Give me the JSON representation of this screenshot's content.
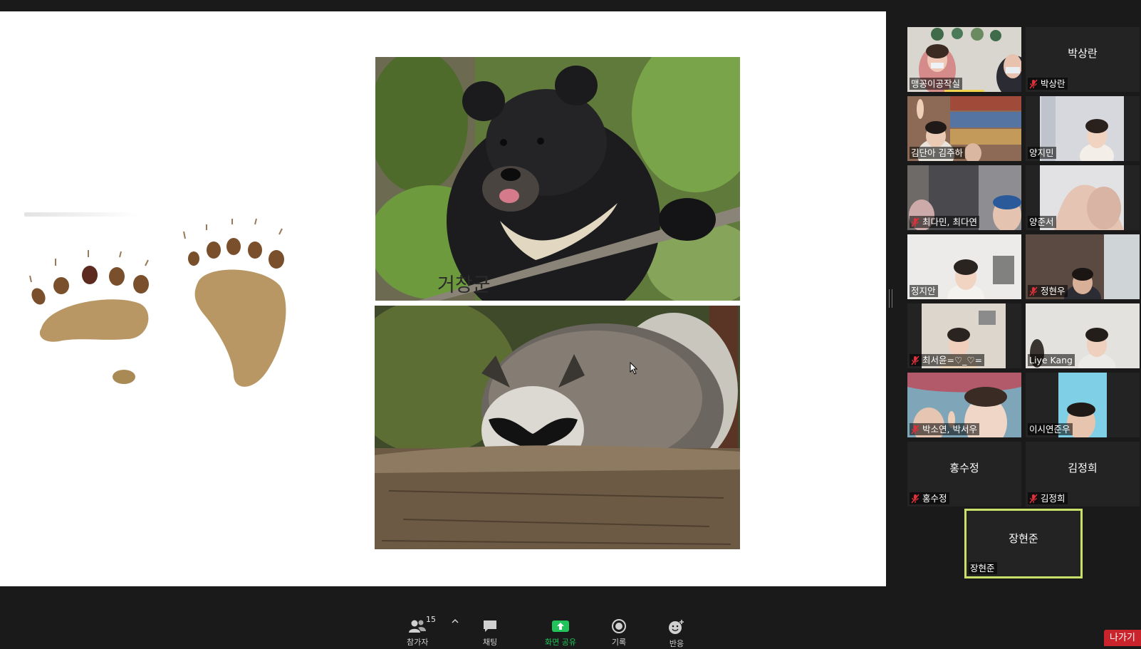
{
  "slide": {
    "annotation_text": "거창군",
    "images": {
      "top": "bear",
      "bottom": "raccoon"
    }
  },
  "gallery": {
    "tiles": [
      {
        "label": "맹꽁이공작실",
        "muted": false,
        "video": true,
        "speaking": true
      },
      {
        "label": "박상란",
        "center_name": "박상란",
        "muted": true,
        "video": false
      },
      {
        "label": "김단아 김주하",
        "muted": false,
        "video": true
      },
      {
        "label": "양지민",
        "muted": false,
        "video": true
      },
      {
        "label": "최다민, 최다연",
        "muted": true,
        "video": true
      },
      {
        "label": "양준서",
        "muted": false,
        "video": true
      },
      {
        "label": "정지안",
        "muted": false,
        "video": true
      },
      {
        "label": "정현우",
        "muted": true,
        "video": true
      },
      {
        "label": "최서윤=♡_♡=",
        "muted": true,
        "video": true
      },
      {
        "label": "Liye Kang",
        "muted": false,
        "video": true
      },
      {
        "label": "박소연, 박서우",
        "muted": true,
        "video": true
      },
      {
        "label": "이시연준우",
        "muted": false,
        "video": true
      },
      {
        "label": "홍수정",
        "center_name": "홍수정",
        "muted": true,
        "video": false
      },
      {
        "label": "김정희",
        "center_name": "김정희",
        "muted": true,
        "video": false
      },
      {
        "label": "장현준",
        "center_name": "장현준",
        "muted": false,
        "video": false,
        "active": true
      }
    ]
  },
  "toolbar": {
    "participants_count": "15",
    "participants_label": "참가자",
    "chat_label": "채팅",
    "share_label": "화면 공유",
    "record_label": "기록",
    "reactions_label": "반응",
    "leave_label": "나가기"
  },
  "colors": {
    "background": "#1a1a1a",
    "tile_bg": "#232323",
    "active_border": "#c9e06a",
    "share_green": "#22c35a",
    "leave_red": "#c9242b",
    "mute_red": "#e0303a",
    "speaking_yellow": "#f2d34c"
  },
  "icons": [
    "participants-icon",
    "chevron-up-icon",
    "chat-icon",
    "share-screen-icon",
    "record-icon",
    "reactions-icon",
    "mic-muted-icon",
    "mouse-cursor-icon"
  ]
}
